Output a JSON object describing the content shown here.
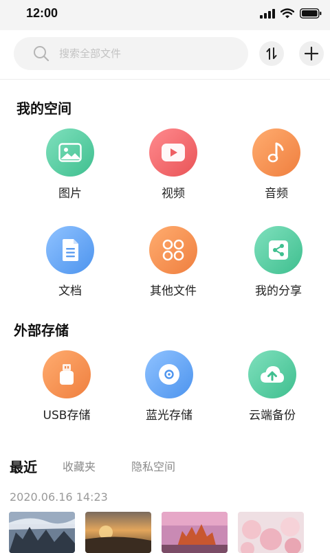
{
  "status_bar": {
    "time": "12:00",
    "icons": [
      "signal-icon",
      "wifi-icon",
      "battery-icon"
    ]
  },
  "search": {
    "placeholder": "搜索全部文件",
    "sort_icon": "sort-icon",
    "add_icon": "plus-icon"
  },
  "my_space": {
    "title": "我的空间",
    "items": [
      {
        "label": "图片",
        "icon": "image-icon",
        "color": "#4fc99c"
      },
      {
        "label": "视频",
        "icon": "video-play-icon",
        "color": "#f06468"
      },
      {
        "label": "音频",
        "icon": "music-note-icon",
        "color": "#f5894a"
      },
      {
        "label": "文档",
        "icon": "document-icon",
        "color": "#5ea0f2"
      },
      {
        "label": "其他文件",
        "icon": "other-files-icon",
        "color": "#f5894a"
      },
      {
        "label": "我的分享",
        "icon": "share-icon",
        "color": "#4fc99c"
      }
    ]
  },
  "external_storage": {
    "title": "外部存储",
    "items": [
      {
        "label": "USB存储",
        "icon": "usb-icon",
        "color": "#f5894a"
      },
      {
        "label": "蓝光存储",
        "icon": "disc-icon",
        "color": "#5ea0f2"
      },
      {
        "label": "云端备份",
        "icon": "cloud-upload-icon",
        "color": "#4fc99c"
      }
    ]
  },
  "tabs": {
    "items": [
      "最近",
      "收藏夹",
      "隐私空间"
    ],
    "active": "最近"
  },
  "recent": {
    "date": "2020.06.16 14:23",
    "thumbnails": 4
  }
}
